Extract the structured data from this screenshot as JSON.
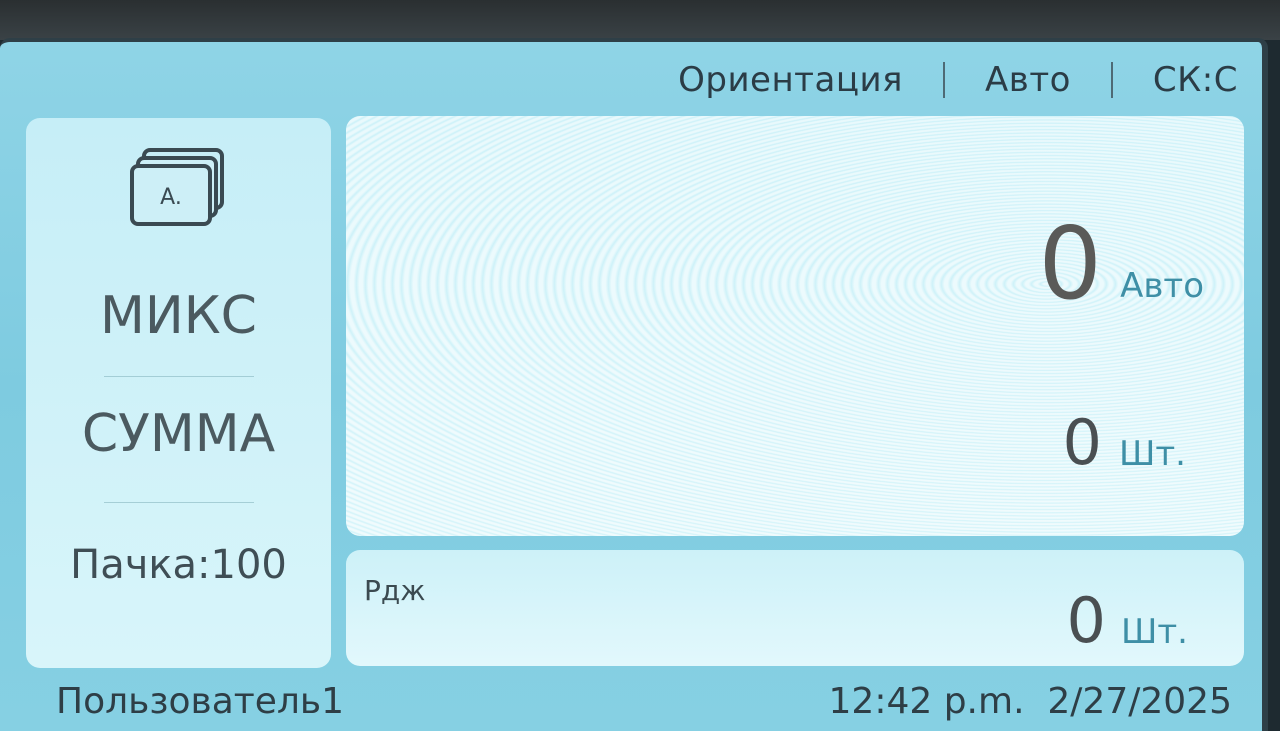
{
  "topbar": {
    "orientation_label": "Ориентация",
    "mode_label": "Авто",
    "sk_label": "СК:С"
  },
  "left_panel": {
    "icon_letter": "A.",
    "mix_label": "МИКС",
    "sum_label": "СУММА",
    "batch_label": "Пачка:100"
  },
  "main_panel": {
    "amount_value": "0",
    "amount_unit": "Авто",
    "count_value": "0",
    "count_unit": "Шт."
  },
  "reject_panel": {
    "label": "Рдж",
    "count_value": "0",
    "count_unit": "Шт."
  },
  "statusbar": {
    "user": "Пользователь1",
    "datetime": "12:42 p.m.  2/27/2025"
  }
}
